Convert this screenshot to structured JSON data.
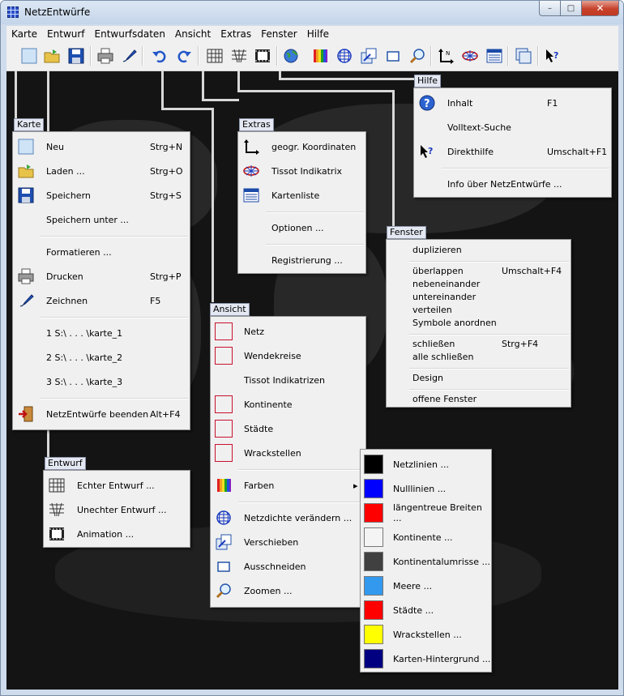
{
  "window": {
    "title": "NetzEntwürfe",
    "minimize": "–",
    "maximize": "□",
    "close": "✕"
  },
  "menubar": [
    "Karte",
    "Entwurf",
    "Entwurfsdaten",
    "Ansicht",
    "Extras",
    "Fenster",
    "Hilfe"
  ],
  "toolbar_icons": [
    "new-icon",
    "open-folder-icon",
    "save-icon",
    "print-icon",
    "draw-pen-icon",
    "undo-icon",
    "redo-icon",
    "true-projection-icon",
    "false-projection-icon",
    "animation-icon",
    "globe-icon",
    "colors-icon",
    "grid-density-icon",
    "move-icon",
    "crop-icon",
    "zoom-icon",
    "coordinates-icon",
    "tissot-icon",
    "map-list-icon",
    "duplicate-window-icon",
    "help-pointer-icon"
  ],
  "karte": {
    "tag": "Karte",
    "items": [
      {
        "label": "Neu",
        "shortcut": "Strg+N",
        "icon": "new-icon"
      },
      {
        "label": "Laden ...",
        "shortcut": "Strg+O",
        "icon": "open-folder-icon"
      },
      {
        "label": "Speichern",
        "shortcut": "Strg+S",
        "icon": "save-icon"
      },
      {
        "label": "Speichern unter ...",
        "shortcut": ""
      },
      {
        "label": "Formatieren ...",
        "shortcut": ""
      },
      {
        "label": "Drucken",
        "shortcut": "Strg+P",
        "icon": "print-icon"
      },
      {
        "label": "Zeichnen",
        "shortcut": "F5",
        "icon": "draw-pen-icon"
      },
      {
        "label": "1  S:\\ . . . \\karte_1",
        "shortcut": ""
      },
      {
        "label": "2  S:\\ . . . \\karte_2",
        "shortcut": ""
      },
      {
        "label": "3  S:\\ . . . \\karte_3",
        "shortcut": ""
      },
      {
        "label": "NetzEntwürfe beenden",
        "shortcut": "Alt+F4",
        "icon": "exit-icon"
      }
    ]
  },
  "entwurf": {
    "tag": "Entwurf",
    "items": [
      {
        "label": "Echter Entwurf ...",
        "icon": "true-projection-icon"
      },
      {
        "label": "Unechter Entwurf ...",
        "icon": "false-projection-icon"
      },
      {
        "label": "Animation ...",
        "icon": "animation-icon"
      }
    ]
  },
  "extras": {
    "tag": "Extras",
    "items": [
      {
        "label": "geogr. Koordinaten",
        "icon": "coordinates-icon"
      },
      {
        "label": "Tissot Indikatrix",
        "icon": "tissot-icon"
      },
      {
        "label": "Kartenliste",
        "icon": "map-list-icon"
      },
      {
        "label": "Optionen ..."
      },
      {
        "label": "Registrierung ..."
      }
    ]
  },
  "hilfe": {
    "tag": "Hilfe",
    "items": [
      {
        "label": "Inhalt",
        "shortcut": "F1",
        "icon": "help-circle-icon"
      },
      {
        "label": "Volltext-Suche",
        "shortcut": ""
      },
      {
        "label": "Direkthilfe",
        "shortcut": "Umschalt+F1",
        "icon": "help-pointer-icon"
      },
      {
        "label": "Info über NetzEntwürfe ...",
        "shortcut": ""
      }
    ]
  },
  "fenster": {
    "tag": "Fenster",
    "items": {
      "duplizieren": "duplizieren",
      "ueberlappen": "überlappen",
      "ueberlappen_shortcut": "Umschalt+F4",
      "nebeneinander": "nebeneinander",
      "untereinander": "untereinander",
      "verteilen": "verteilen",
      "symbole": "Symbole anordnen",
      "schliessen": "schließen",
      "schliessen_shortcut": "Strg+F4",
      "alle_schliessen": "alle schließen",
      "design": "Design",
      "offene_fenster": "offene Fenster"
    }
  },
  "ansicht": {
    "tag": "Ansicht",
    "items": [
      {
        "label": "Netz",
        "checkbox": true
      },
      {
        "label": "Wendekreise",
        "checkbox": true
      },
      {
        "label": "Tissot Indikatrizen",
        "checkbox": false
      },
      {
        "label": "Kontinente",
        "checkbox": true
      },
      {
        "label": "Städte",
        "checkbox": true
      },
      {
        "label": "Wrackstellen",
        "checkbox": true
      },
      {
        "label": "Farben",
        "icon": "colors-icon",
        "submenu_arrow": "▸"
      },
      {
        "label": "Netzdichte verändern ...",
        "icon": "grid-density-icon"
      },
      {
        "label": "Verschieben",
        "icon": "move-icon"
      },
      {
        "label": "Ausschneiden",
        "icon": "crop-icon"
      },
      {
        "label": "Zoomen ...",
        "icon": "zoom-icon"
      }
    ]
  },
  "farben": {
    "items": [
      {
        "label": "Netzlinien ...",
        "color": "#000000"
      },
      {
        "label": "Nulllinien ...",
        "color": "#0000ff"
      },
      {
        "label": "längentreue Breiten ...",
        "color": "#ff0000"
      },
      {
        "label": "Kontinente ...",
        "color": "#f4f4f4"
      },
      {
        "label": "Kontinentalumrisse ...",
        "color": "#404040"
      },
      {
        "label": "Meere ...",
        "color": "#3399ee"
      },
      {
        "label": "Städte ...",
        "color": "#ff0000"
      },
      {
        "label": "Wrackstellen ...",
        "color": "#ffff00"
      },
      {
        "label": "Karten-Hintergrund ...",
        "color": "#000080"
      }
    ]
  }
}
